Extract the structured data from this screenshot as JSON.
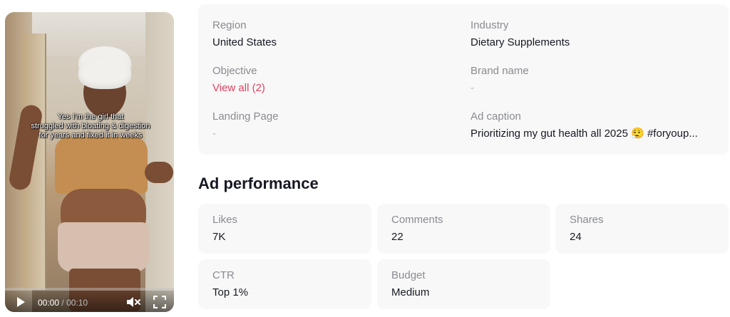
{
  "video": {
    "overlay_caption_lines": [
      "Yes I'm the girl that",
      "struggled with bloating & digestion",
      "for years and fixed it in weeks"
    ],
    "current_time": "00:00",
    "separator": "/",
    "duration": "00:10",
    "progress_fraction": 0.0,
    "icons": {
      "play": "play-icon",
      "mute": "mute-icon",
      "fullscreen": "fullscreen-icon"
    }
  },
  "info": {
    "region": {
      "label": "Region",
      "value": "United States"
    },
    "industry": {
      "label": "Industry",
      "value": "Dietary Supplements"
    },
    "objective": {
      "label": "Objective",
      "value": "View all (2)"
    },
    "brand_name": {
      "label": "Brand name",
      "value": "-"
    },
    "landing_page": {
      "label": "Landing Page",
      "value": "-"
    },
    "ad_caption": {
      "label": "Ad caption",
      "value": "Prioritizing my gut health all 2025 😮‍💨 #foryoup..."
    }
  },
  "performance": {
    "title": "Ad performance",
    "metrics": [
      {
        "label": "Likes",
        "value": "7K"
      },
      {
        "label": "Comments",
        "value": "22"
      },
      {
        "label": "Shares",
        "value": "24"
      },
      {
        "label": "CTR",
        "value": "Top 1%"
      },
      {
        "label": "Budget",
        "value": "Medium"
      }
    ]
  },
  "colors": {
    "accent_link": "#e0425f",
    "progress": "#fe2c55",
    "card_bg": "#f8f8f8",
    "label_gray": "#8a8b91"
  }
}
